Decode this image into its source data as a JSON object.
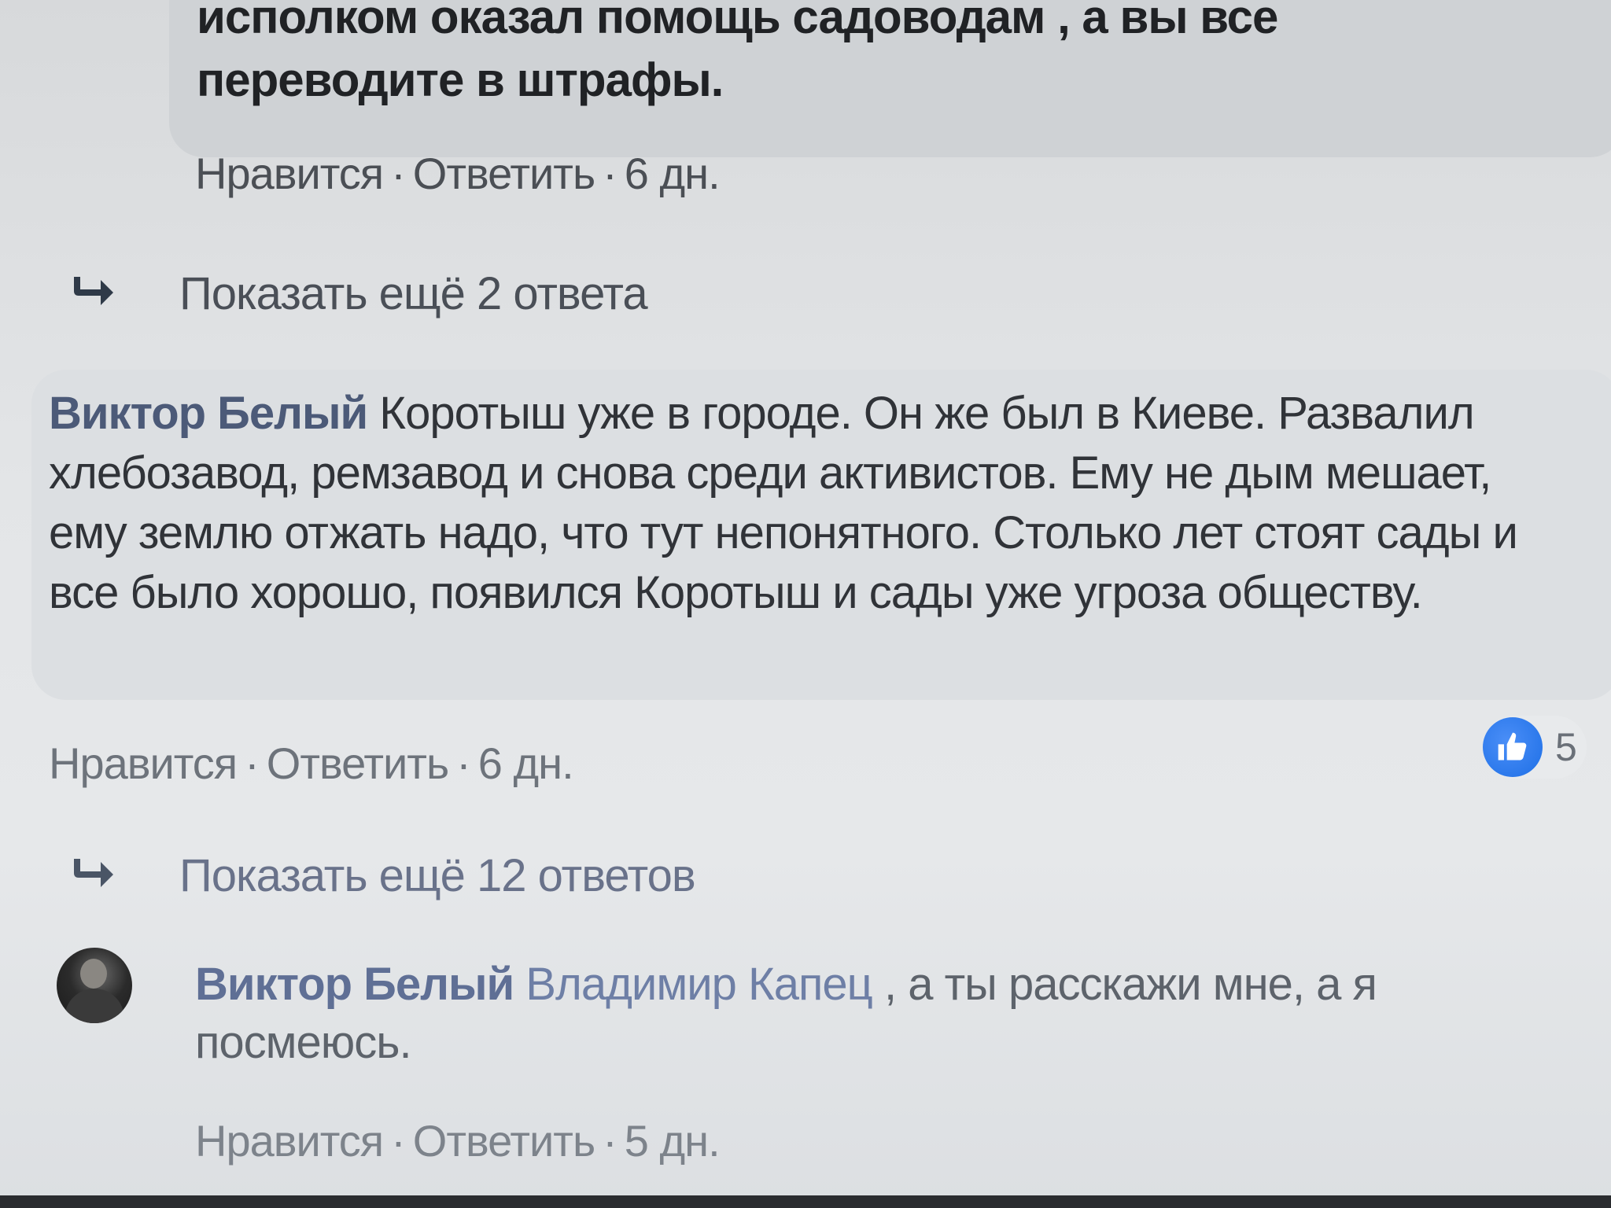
{
  "top_comment": {
    "text_line1": "исполком оказал помощь садоводам , а вы все",
    "text_line2": "переводите в штрафы.",
    "actions": {
      "like": "Нравится",
      "reply": "Ответить",
      "time": "6 дн."
    }
  },
  "more_replies_1": {
    "label": "Показать ещё 2 ответа"
  },
  "main_comment": {
    "author": "Виктор Белый",
    "text": "Коротыш уже в городе. Он же был в Киеве. Развалил хлебозавод, ремзавод и снова среди активистов. Ему не дым мешает, ему землю отжать надо, что тут непонятного. Столько лет стоят сады и все было хорошо, появился Коротыш и сады уже угроза обществу.",
    "actions": {
      "like": "Нравится",
      "reply": "Ответить",
      "time": "6 дн."
    },
    "reactions": {
      "icon": "thumbs-up-icon",
      "count": "5"
    }
  },
  "more_replies_2": {
    "label": "Показать ещё 12 ответов"
  },
  "reply_comment": {
    "author": "Виктор Белый",
    "mention": "Владимир Капец",
    "text": " , а ты расскажи мне, а я посмеюсь.",
    "actions": {
      "like": "Нравится",
      "reply": "Ответить",
      "time": "5 дн."
    }
  }
}
